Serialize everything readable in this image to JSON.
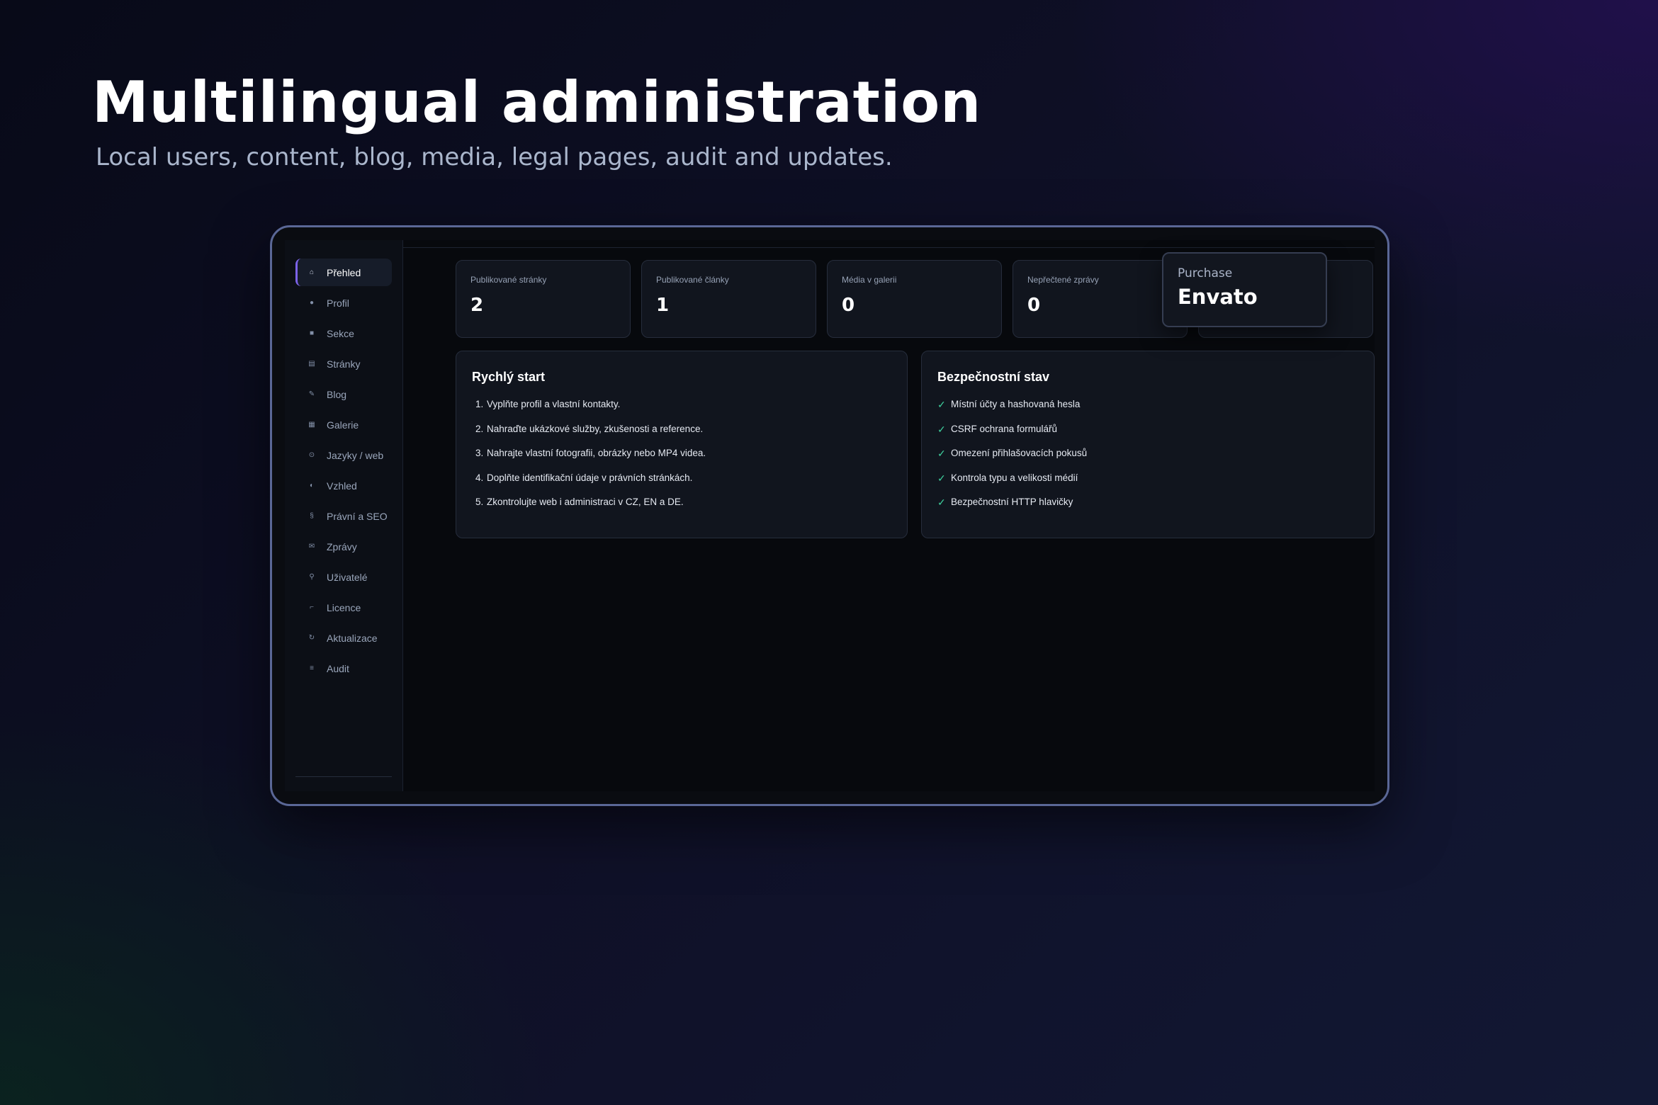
{
  "hero": {
    "title": "Multilingual administration",
    "subtitle": "Local users, content, blog, media, legal pages, audit and updates."
  },
  "sidebar": {
    "items": [
      {
        "label": "Přehled",
        "icon": "home-icon",
        "glyph": "⌂",
        "active": true
      },
      {
        "label": "Profil",
        "icon": "dot-icon",
        "glyph": "●",
        "active": false
      },
      {
        "label": "Sekce",
        "icon": "square-icon",
        "glyph": "■",
        "active": false
      },
      {
        "label": "Stránky",
        "icon": "page-icon",
        "glyph": "▤",
        "active": false
      },
      {
        "label": "Blog",
        "icon": "pen-icon",
        "glyph": "✎",
        "active": false
      },
      {
        "label": "Galerie",
        "icon": "gallery-icon",
        "glyph": "▦",
        "active": false
      },
      {
        "label": "Jazyky / web",
        "icon": "globe-icon",
        "glyph": "⊙",
        "active": false
      },
      {
        "label": "Vzhled",
        "icon": "contrast-icon",
        "glyph": "◐",
        "active": false
      },
      {
        "label": "Právní a SEO",
        "icon": "section-icon",
        "glyph": "§",
        "active": false
      },
      {
        "label": "Zprávy",
        "icon": "mail-icon",
        "glyph": "✉",
        "active": false
      },
      {
        "label": "Uživatelé",
        "icon": "user-icon",
        "glyph": "⚲",
        "active": false
      },
      {
        "label": "Licence",
        "icon": "key-icon",
        "glyph": "⌐",
        "active": false
      },
      {
        "label": "Aktualizace",
        "icon": "refresh-icon",
        "glyph": "↻",
        "active": false
      },
      {
        "label": "Audit",
        "icon": "list-icon",
        "glyph": "≡",
        "active": false
      }
    ]
  },
  "stats": [
    {
      "label": "Publikované stránky",
      "value": "2"
    },
    {
      "label": "Publikované články",
      "value": "1"
    },
    {
      "label": "Média v galerii",
      "value": "0"
    },
    {
      "label": "Nepřečtené zprávy",
      "value": "0"
    },
    {
      "label": "",
      "value": ""
    }
  ],
  "quick_start": {
    "title": "Rychlý start",
    "items": [
      {
        "num": "1.",
        "text": "Vyplňte profil a vlastní kontakty."
      },
      {
        "num": "2.",
        "text": "Nahraďte ukázkové služby, zkušenosti a reference."
      },
      {
        "num": "3.",
        "text": "Nahrajte vlastní fotografii, obrázky nebo MP4 videa."
      },
      {
        "num": "4.",
        "text": "Doplňte identifikační údaje v právních stránkách."
      },
      {
        "num": "5.",
        "text": "Zkontrolujte web i administraci v CZ, EN a DE."
      }
    ]
  },
  "security": {
    "title": "Bezpečnostní stav",
    "check_glyph": "✓",
    "check_color": "#3ecf9d",
    "items": [
      "Místní účty a hashovaná hesla",
      "CSRF ochrana formulářů",
      "Omezení přihlašovacích pokusů",
      "Kontrola typu a velikosti médií",
      "Bezpečnostní HTTP hlavičky"
    ]
  },
  "badge": {
    "label": "Purchase",
    "value": "Envato"
  },
  "colors": {
    "accent": "#7b62e8",
    "frame_border": "#5a6796",
    "card_bg": "#11151e"
  }
}
